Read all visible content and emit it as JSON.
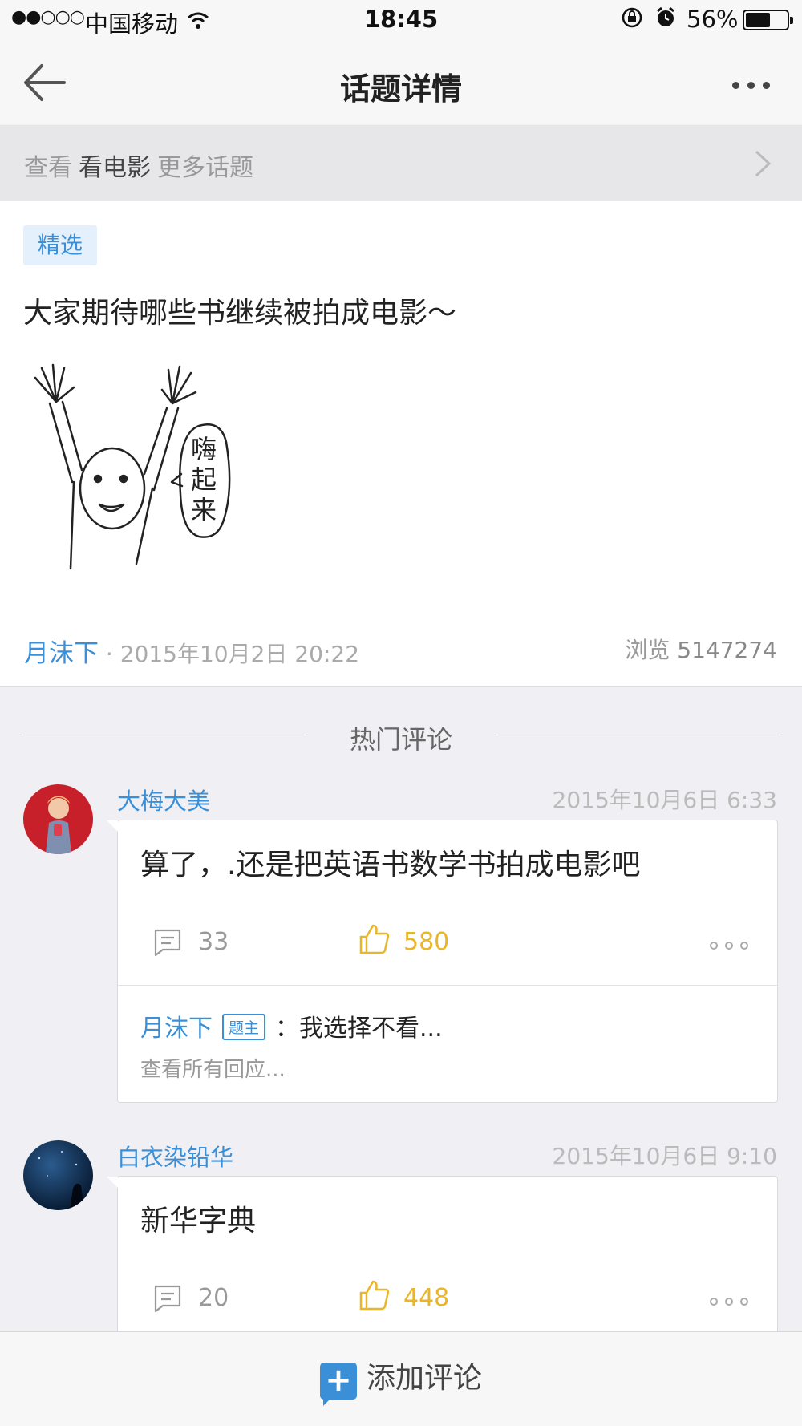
{
  "status_bar": {
    "signal": "●●○○○",
    "carrier": "中国移动",
    "time": "18:45",
    "battery_percent": "56%",
    "battery_level": 0.56
  },
  "nav": {
    "title": "话题详情",
    "back_icon": "arrow-left-icon",
    "more_icon": "more-dots-icon"
  },
  "topic_link": {
    "prefix": "查看",
    "topic": "看电影",
    "suffix": "更多话题"
  },
  "post": {
    "badge": "精选",
    "headline": "大家期待哪些书继续被拍成电影～",
    "image_text": [
      "嗨",
      "起",
      "来"
    ],
    "author": "月沫下",
    "separator": "·",
    "datetime": "2015年10月2日 20:22",
    "views_label": "浏览",
    "views_count": "5147274"
  },
  "section": {
    "title": "热门评论"
  },
  "comments": [
    {
      "name": "大梅大美",
      "date": "2015年10月6日 6:33",
      "text": "算了，.还是把英语书数学书拍成电影吧",
      "reply_count": "33",
      "like_count": "580",
      "reply": {
        "author": "月沫下",
        "tag": "题主",
        "colon": "：",
        "text": "我选择不看...",
        "see_all": "查看所有回应..."
      }
    },
    {
      "name": "白衣染铅华",
      "date": "2015年10月6日 9:10",
      "text": "新华字典",
      "reply_count": "20",
      "like_count": "448"
    }
  ],
  "bottom": {
    "add_comment": "添加评论"
  },
  "colors": {
    "accent": "#3b8fd6",
    "like": "#e8b628",
    "background": "#efeff4"
  }
}
